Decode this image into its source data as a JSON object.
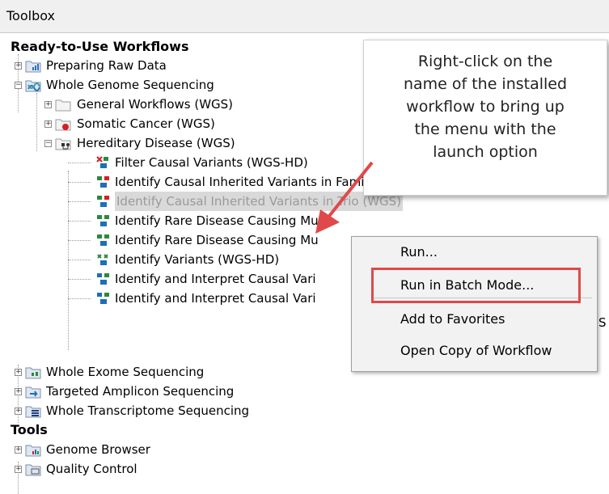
{
  "window": {
    "title": "Toolbox"
  },
  "sections": {
    "workflows": "Ready-to-Use Workflows",
    "tools": "Tools"
  },
  "tree": {
    "preparing_raw_data": "Preparing Raw Data",
    "whole_genome": "Whole Genome Sequencing",
    "general_workflows": "General Workflows (WGS)",
    "somatic_cancer": "Somatic Cancer (WGS)",
    "hereditary_disease": "Hereditary Disease (WGS)",
    "wf_filter": "Filter Causal Variants (WGS-HD)",
    "wf_family_four": "Identify Causal Inherited Variants in Family of Four (WGS)",
    "wf_trio": "Identify Causal Inherited Variants in Trio (WGS)",
    "wf_rare_1": "Identify Rare Disease Causing Mu",
    "wf_rare_2": "Identify Rare Disease Causing Mu",
    "wf_variants": "Identify Variants (WGS-HD)",
    "wf_interpret_1": "Identify and Interpret Causal Vari",
    "wf_interpret_2": "Identify and Interpret Causal Vari",
    "whole_exome": "Whole Exome Sequencing",
    "targeted_amplicon": "Targeted Amplicon Sequencing",
    "whole_transcriptome": "Whole Transcriptome Sequencing",
    "genome_browser": "Genome Browser",
    "quality_control": "Quality Control",
    "truncated_suffix": "S"
  },
  "callout": {
    "lines": [
      "Right-click on the",
      "name of the installed",
      "workflow to bring up",
      "the menu with the",
      "launch option"
    ]
  },
  "context_menu": {
    "run": "Run...",
    "run_batch": "Run in Batch Mode...",
    "add_favorites": "Add to Favorites",
    "open_copy": "Open Copy of Workflow"
  },
  "colors": {
    "arrow": "#e0494a",
    "highlight_box": "#e0494a",
    "selected_row_bg": "#d9d9d9"
  }
}
